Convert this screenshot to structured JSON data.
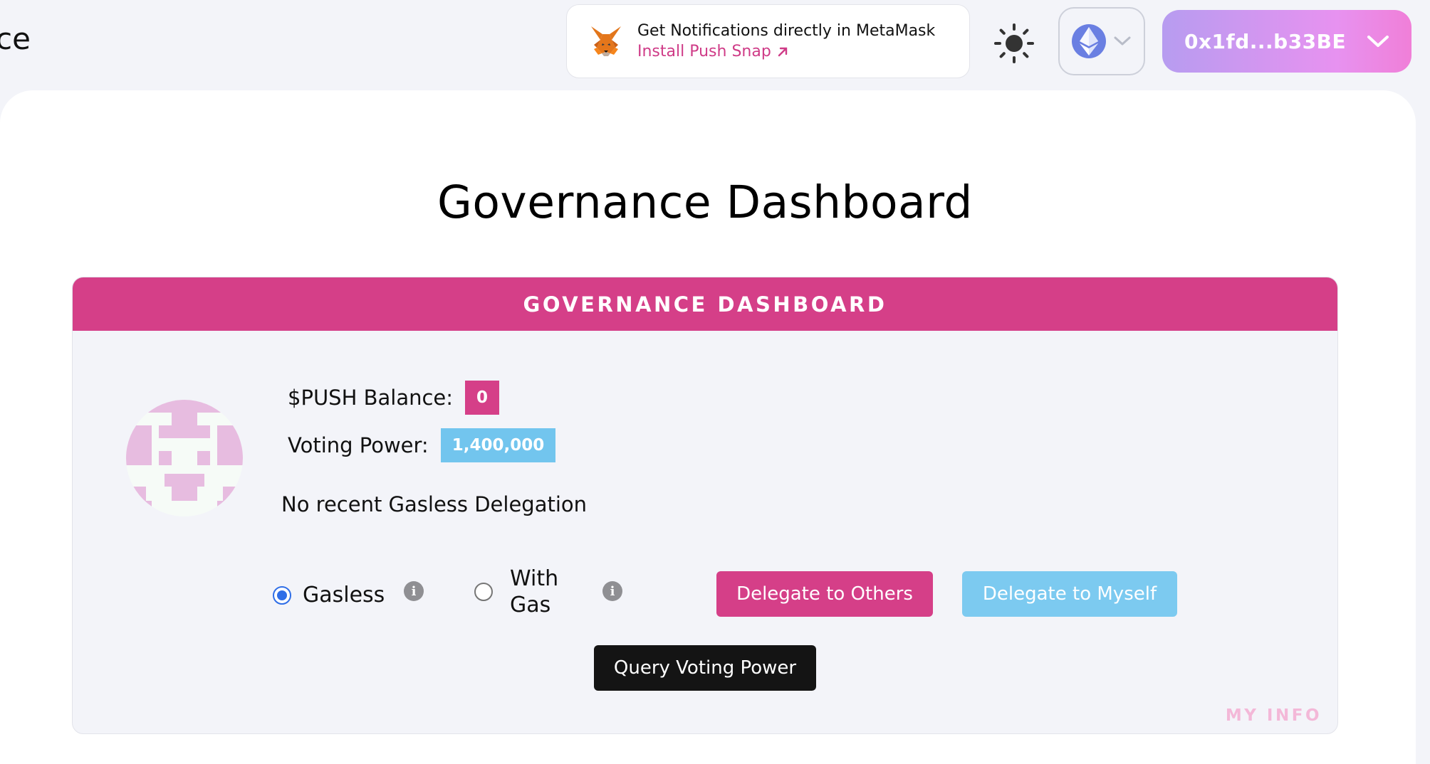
{
  "header": {
    "partial_title": "ce",
    "snap_promo": {
      "title": "Get Notifications directly in MetaMask",
      "link": "Install Push Snap",
      "link_icon": "arrow-up-right-icon"
    },
    "theme_icon": "sun-icon",
    "chain_icon": "ethereum-icon",
    "wallet": {
      "address": "0x1fd...b33BE",
      "dropdown_icon": "chevron-down-icon"
    }
  },
  "page": {
    "title": "Governance Dashboard"
  },
  "dashboard": {
    "header": "GOVERNANCE DASHBOARD",
    "balance_label": "$PUSH Balance:",
    "balance_value": "0",
    "voting_label": "Voting Power:",
    "voting_value": "1,400,000",
    "delegation_status": "No recent Gasless Delegation",
    "options": [
      {
        "label": "Gasless",
        "selected": true
      },
      {
        "label_line1": "With",
        "label_line2": "Gas",
        "selected": false
      }
    ],
    "buttons": {
      "delegate_others": "Delegate to Others",
      "delegate_myself": "Delegate to Myself",
      "query": "Query Voting Power"
    },
    "footer_label": "MY INFO"
  },
  "colors": {
    "brand_pink": "#d53f88",
    "accent_blue": "#72c5ee",
    "link_pink": "#cf3b87",
    "radio_blue": "#2f6ee7"
  }
}
